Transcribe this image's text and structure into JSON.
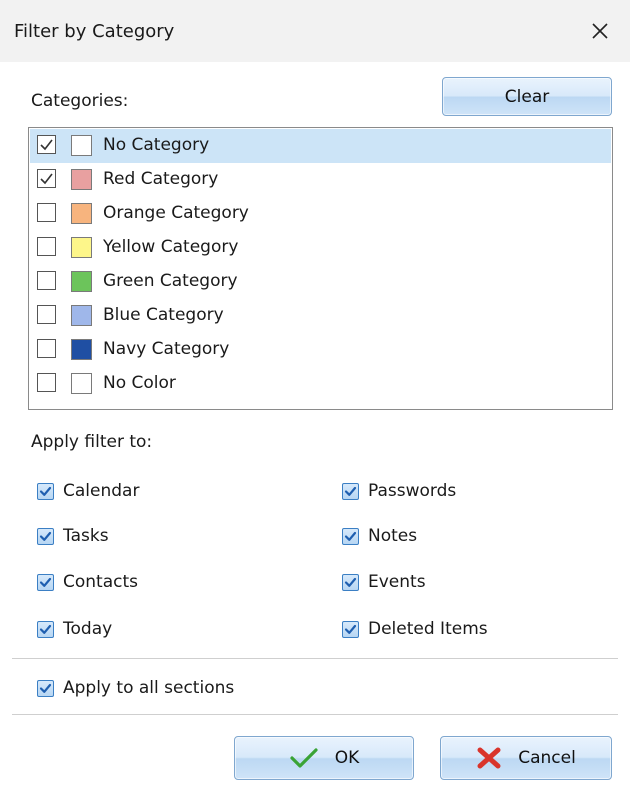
{
  "window": {
    "title": "Filter by Category"
  },
  "categories": {
    "label": "Categories:",
    "clear_label": "Clear",
    "items": [
      {
        "label": "No Category",
        "checked": true,
        "color": "#ffffff",
        "selected": true
      },
      {
        "label": "Red Category",
        "checked": true,
        "color": "#e8a0a0",
        "selected": false
      },
      {
        "label": "Orange Category",
        "checked": false,
        "color": "#f7b47e",
        "selected": false
      },
      {
        "label": "Yellow Category",
        "checked": false,
        "color": "#fdf68a",
        "selected": false
      },
      {
        "label": "Green Category",
        "checked": false,
        "color": "#6cc45b",
        "selected": false
      },
      {
        "label": "Blue Category",
        "checked": false,
        "color": "#9fb7ea",
        "selected": false
      },
      {
        "label": "Navy Category",
        "checked": false,
        "color": "#1f4fa3",
        "selected": false
      },
      {
        "label": "No Color",
        "checked": false,
        "color": "#ffffff",
        "selected": false
      }
    ]
  },
  "apply_filter": {
    "label": "Apply filter to:",
    "sections": [
      {
        "label": "Calendar",
        "checked": true
      },
      {
        "label": "Tasks",
        "checked": true
      },
      {
        "label": "Contacts",
        "checked": true
      },
      {
        "label": "Today",
        "checked": true
      },
      {
        "label": "Passwords",
        "checked": true
      },
      {
        "label": "Notes",
        "checked": true
      },
      {
        "label": "Events",
        "checked": true
      },
      {
        "label": "Deleted Items",
        "checked": true
      }
    ],
    "all_sections_label": "Apply to all sections",
    "all_sections_checked": true
  },
  "footer": {
    "ok_label": "OK",
    "cancel_label": "Cancel"
  },
  "colors": {
    "selection": "#cce4f7",
    "check_blue": "#1f5fb0",
    "ok_green": "#3aa335",
    "cancel_red": "#d9342b"
  }
}
